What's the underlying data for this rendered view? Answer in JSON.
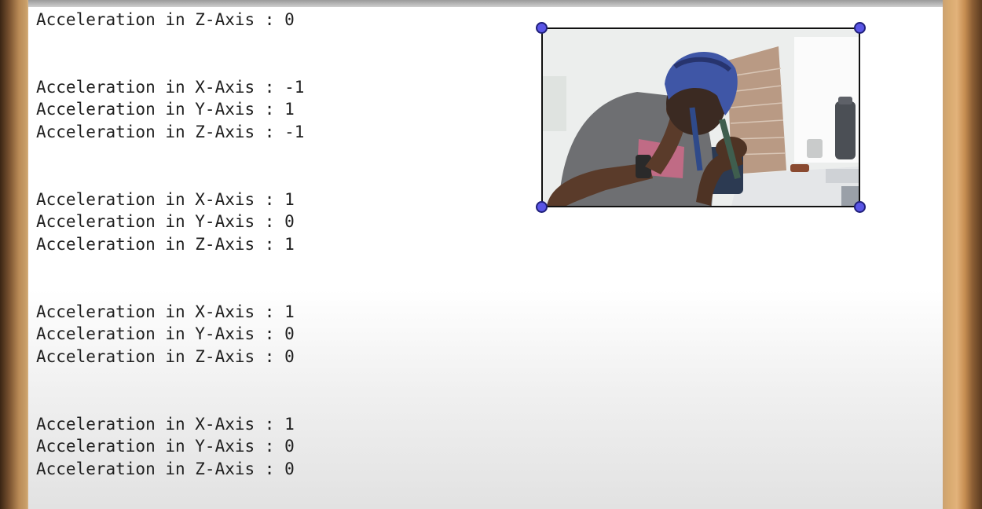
{
  "console": {
    "lines": [
      "Acceleration in Z-Axis : 0",
      "Acceleration in X-Axis : -1",
      "Acceleration in Y-Axis : 1",
      "Acceleration in Z-Axis : -1",
      "Acceleration in X-Axis : 1",
      "Acceleration in Y-Axis : 0",
      "Acceleration in Z-Axis : 1",
      "Acceleration in X-Axis : 1",
      "Acceleration in Y-Axis : 0",
      "Acceleration in Z-Axis : 0",
      "Acceleration in X-Axis : 1",
      "Acceleration in Y-Axis : 0",
      "Acceleration in Z-Axis : 0"
    ]
  },
  "video_overlay": {
    "subject": "person in blue boxing headgear and gray t-shirt",
    "handle_color": "#5a55e6"
  },
  "colors": {
    "console_bg": "#ffffff",
    "console_text": "#1f1f1f",
    "desk_wood": "#c89a62"
  }
}
